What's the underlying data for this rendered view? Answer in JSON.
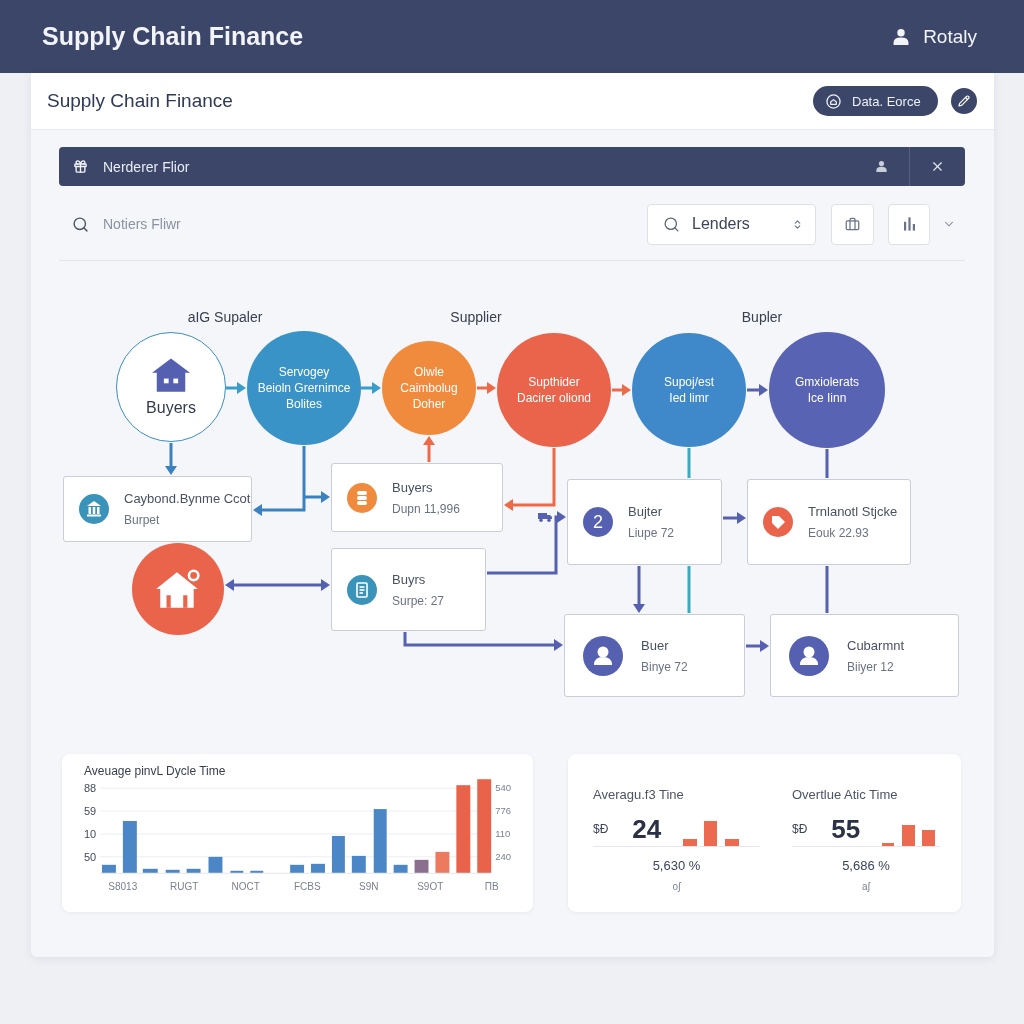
{
  "app_bar": {
    "title": "Supply Chain Finance",
    "user": "Rotaly"
  },
  "panel": {
    "title": "Supply Chain Finance",
    "action_button": "Data. Eorce"
  },
  "banner": {
    "title": "Nerderer Flior"
  },
  "filters": {
    "search": {
      "placeholder": "Notiers Fliwr"
    },
    "select": {
      "value": "Lenders"
    }
  },
  "diagram": {
    "column_headers": [
      "aIG Supaler",
      "Supplier",
      "Bupler"
    ],
    "stages": [
      {
        "kind": "outline",
        "label": "Buyers",
        "color": "#3b8ec0"
      },
      {
        "kind": "filled",
        "label": "Servogey\nBeioln Grernimce\nBolites",
        "color": "#3a93c6"
      },
      {
        "kind": "filled",
        "label": "Olwle\nCaimbolug\nDoher",
        "color": "#f08a3c"
      },
      {
        "kind": "filled",
        "label": "Supthider\nDacirer oliond",
        "color": "#e9644b"
      },
      {
        "kind": "filled",
        "label": "Supoj/est\nIed limr",
        "color": "#3f88c9"
      },
      {
        "kind": "filled",
        "label": "Gmxiolerats\nIce Iinn",
        "color": "#5863b3"
      }
    ],
    "cards": [
      {
        "kind": "icon",
        "color": "#3a93b8",
        "title": "Caybond.Bynme Ccot",
        "detail": "Burpet"
      },
      {
        "kind": "icon",
        "color": "#f08a3c",
        "title": "Buyers",
        "detail": "Dupn 11,996"
      },
      {
        "kind": "icon",
        "color": "#3a93b8",
        "title": "Buyrs",
        "detail": "Surpe: 27"
      },
      {
        "kind": "number",
        "color": "#5560b0",
        "badge": "2",
        "title": "Bujter",
        "detail": "Liupe 72"
      },
      {
        "kind": "icon",
        "color": "#e9644b",
        "title": "Trnlanotl Stjcke",
        "detail": "Eouk 22.93"
      },
      {
        "kind": "avatar",
        "color": "#5560b0",
        "title": "Buer",
        "detail": "Binye 72"
      },
      {
        "kind": "avatar",
        "color": "#5560b0",
        "title": "Cubarmnt",
        "detail": "Biiyer 12"
      }
    ]
  },
  "cycle_chart": {
    "title": "Aveuage pinvL Dycle Time",
    "left_axis": [
      "88",
      "59",
      "10",
      "50"
    ],
    "right_axis": [
      "540",
      "776",
      "110",
      "240"
    ],
    "x_labels": [
      "S8013",
      "RUGT",
      "NOCT",
      "FCBS",
      "S9N",
      "S9OT",
      "ΠB"
    ]
  },
  "metrics": [
    {
      "title": "Averagu.f3 Tine",
      "unit": "$Ð",
      "value": "24",
      "change": "5,630 %",
      "note": "oʃ"
    },
    {
      "title": "Overtlue Atic Time",
      "unit": "$Ð",
      "value": "55",
      "change": "5,686 %",
      "note": "aʃ"
    }
  ]
}
